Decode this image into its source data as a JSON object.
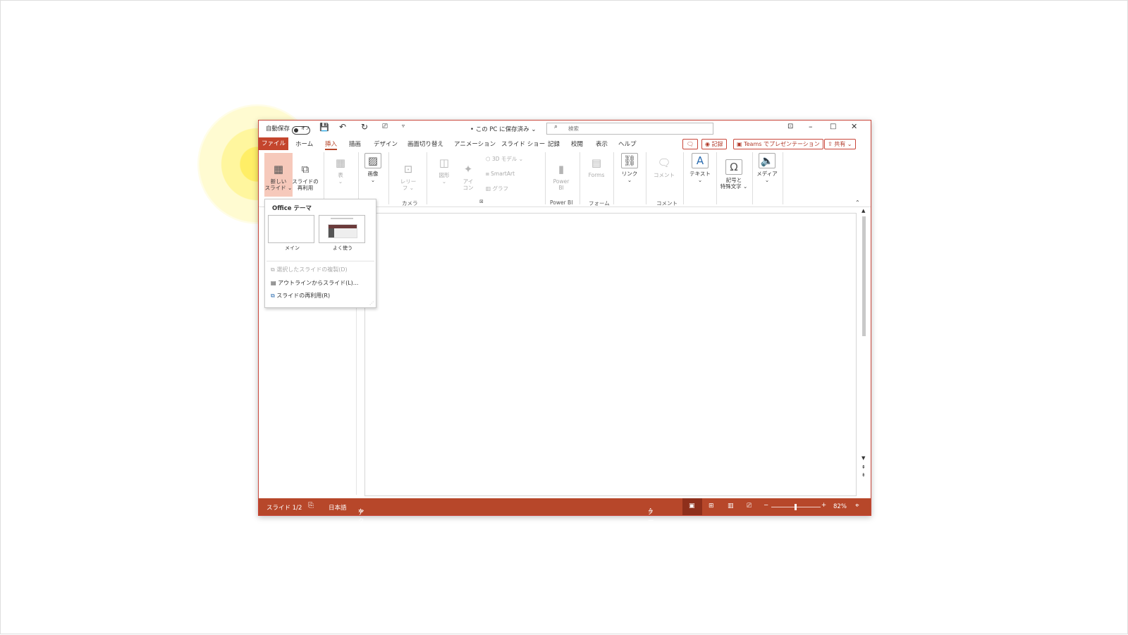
{
  "title_bar": {
    "autosave_label": "自動保存",
    "autosave_state": "オフ",
    "doc_title": "• この PC に保存済み ⌄",
    "search_placeholder": "検索"
  },
  "tabs": [
    "ファイル",
    "ホーム",
    "挿入",
    "描画",
    "デザイン",
    "画面切り替え",
    "アニメーション",
    "スライド ショー",
    "記録",
    "校閲",
    "表示",
    "ヘルプ"
  ],
  "active_tab": "挿入",
  "tab_right": {
    "record": "記録",
    "teams": "Teams でプレゼンテーション",
    "share": "共有"
  },
  "ribbon": {
    "new_slide": "新しい\nスライド ⌄",
    "reuse": "スライドの\n再利用",
    "table": "表",
    "image": "画像",
    "cameo": "レリー\nフ ⌄",
    "shape": "図形",
    "icon": "アイ\nコン",
    "model3d": "3D モデル",
    "smartart": "SmartArt",
    "chart": "グラフ",
    "powerbi": "Power\nBI",
    "forms": "Forms",
    "link": "リンク",
    "comment": "コメント",
    "text": "テキスト",
    "symbols": "記号と\n特殊文字 ⌄",
    "media": "メディア",
    "groups": {
      "camera": "カメラ",
      "powerbi": "Power BI",
      "forms": "フォーム",
      "comment": "コメント"
    }
  },
  "dropdown": {
    "header": "Office テーマ",
    "layouts": [
      "メイン",
      "よく使う"
    ],
    "items": [
      {
        "label": "選択したスライドの複製(D)",
        "enabled": false
      },
      {
        "label": "アウトラインからスライド(L)...",
        "enabled": true
      },
      {
        "label": "スライドの再利用(R)",
        "enabled": true
      }
    ]
  },
  "status": {
    "slide": "スライド 1/2",
    "language": "日本語",
    "accessibility": "アクセシビリティ: 検討が必要です",
    "notes": "ノート",
    "zoom": "82%"
  },
  "colors": {
    "accent": "#b7472a",
    "file_tab": "#c4452d",
    "highlight": "#f6c9bb"
  }
}
